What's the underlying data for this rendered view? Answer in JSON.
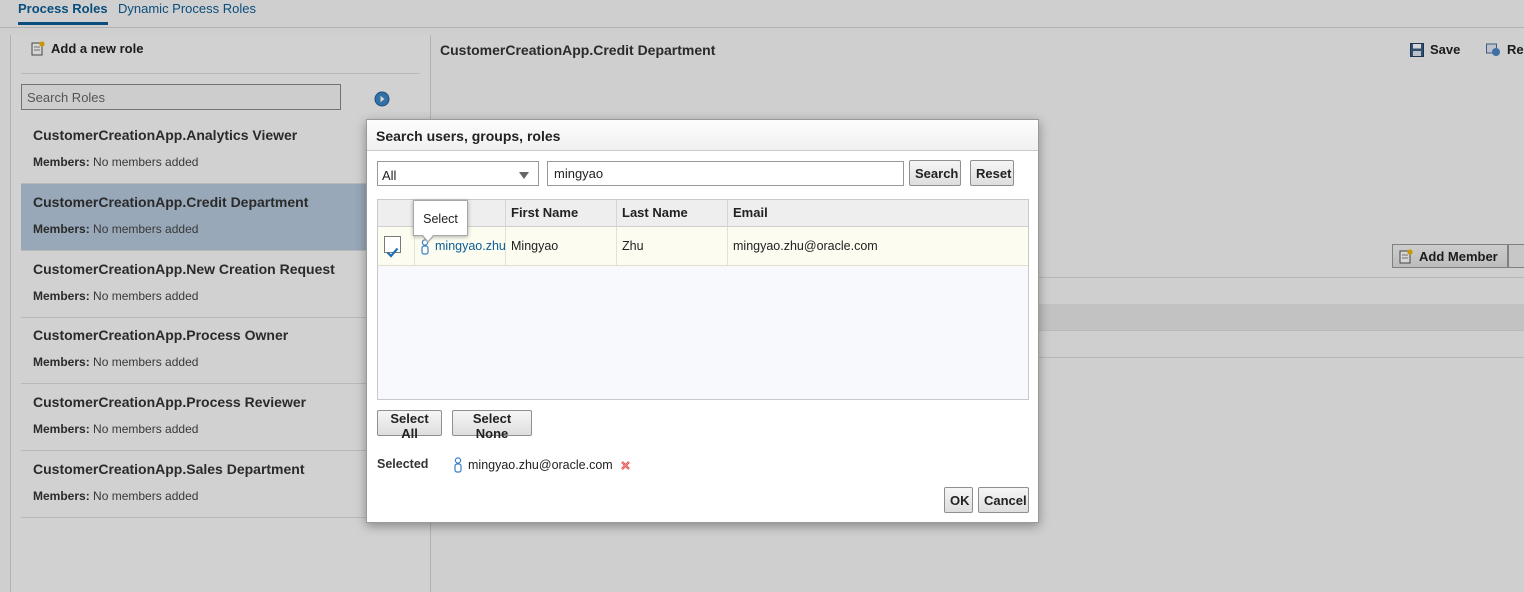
{
  "tabs": [
    {
      "label": "Process Roles",
      "active": true
    },
    {
      "label": "Dynamic Process Roles",
      "active": false
    }
  ],
  "left": {
    "add_role_label": "Add a new role",
    "search_placeholder": "Search Roles",
    "roles": [
      {
        "name": "CustomerCreationApp.Analytics Viewer",
        "members_label": "Members:",
        "members_value": "No members added",
        "selected": false
      },
      {
        "name": "CustomerCreationApp.Credit Department",
        "members_label": "Members:",
        "members_value": "No members added",
        "selected": true
      },
      {
        "name": "CustomerCreationApp.New Creation Request",
        "members_label": "Members:",
        "members_value": "No members added",
        "selected": false
      },
      {
        "name": "CustomerCreationApp.Process Owner",
        "members_label": "Members:",
        "members_value": "No members added",
        "selected": false
      },
      {
        "name": "CustomerCreationApp.Process Reviewer",
        "members_label": "Members:",
        "members_value": "No members added",
        "selected": false
      },
      {
        "name": "CustomerCreationApp.Sales Department",
        "members_label": "Members:",
        "members_value": "No members added",
        "selected": false
      }
    ]
  },
  "right": {
    "title": "CustomerCreationApp.Credit Department",
    "save_label": "Save",
    "revert_label": "Re",
    "add_member_label": "Add Member"
  },
  "dialog": {
    "title": "Search users, groups, roles",
    "scope_value": "All",
    "query_value": "mingyao",
    "search_label": "Search",
    "reset_label": "Reset",
    "columns": [
      "",
      "First Name",
      "Last Name",
      "Email"
    ],
    "rows": [
      {
        "checked": true,
        "user": "mingyao.zhu",
        "first": "Mingyao",
        "last": "Zhu",
        "email": "mingyao.zhu@oracle.com"
      }
    ],
    "tooltip": "Select",
    "select_all_label": "Select All",
    "select_none_label": "Select None",
    "selected_label": "Selected",
    "selected_items": [
      "mingyao.zhu@oracle.com"
    ],
    "ok_label": "OK",
    "cancel_label": "Cancel"
  },
  "colors": {
    "accent": "#0b5d96",
    "selected_role_bg": "#b5c9dc",
    "remove_icon": "#e04848"
  }
}
